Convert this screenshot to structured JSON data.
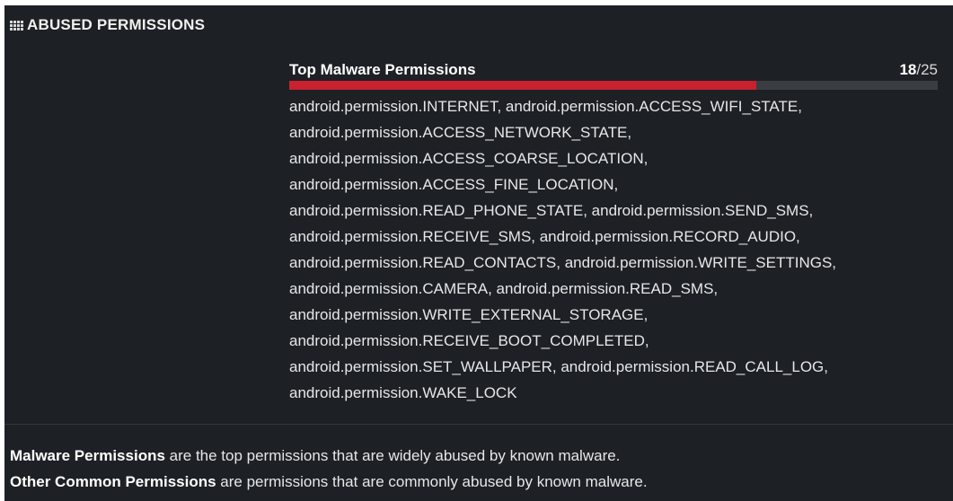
{
  "section": {
    "title": "ABUSED PERMISSIONS",
    "icon": "grid-dots-icon"
  },
  "panel": {
    "title": "Top Malware Permissions",
    "score": {
      "count": "18",
      "total": "/25"
    },
    "progress_fraction": 0.72,
    "bar_color": "#c8212f",
    "permissions_text": "android.permission.INTERNET, android.permission.ACCESS_WIFI_STATE, android.permission.ACCESS_NETWORK_STATE, android.permission.ACCESS_COARSE_LOCATION, android.permission.ACCESS_FINE_LOCATION, android.permission.READ_PHONE_STATE, android.permission.SEND_SMS, android.permission.RECEIVE_SMS, android.permission.RECORD_AUDIO, android.permission.READ_CONTACTS, android.permission.WRITE_SETTINGS, android.permission.CAMERA, android.permission.READ_SMS, android.permission.WRITE_EXTERNAL_STORAGE, android.permission.RECEIVE_BOOT_COMPLETED, android.permission.SET_WALLPAPER, android.permission.READ_CALL_LOG, android.permission.WAKE_LOCK"
  },
  "footer": {
    "line1_bold": "Malware Permissions",
    "line1_rest": " are the top permissions that are widely abused by known malware.",
    "line2_bold": "Other Common Permissions",
    "line2_rest": " are permissions that are commonly abused by known malware."
  }
}
